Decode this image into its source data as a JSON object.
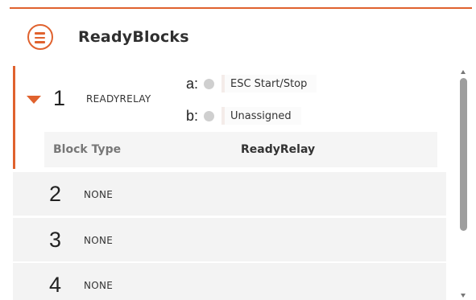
{
  "header": {
    "title": "ReadyBlocks",
    "menu_icon": "hamburger-menu-icon",
    "accent": "#e0622e"
  },
  "blocks": [
    {
      "number": "1",
      "type": "READYRELAY",
      "expanded": true,
      "inputs": [
        {
          "key": "a:",
          "value": "ESC Start/Stop"
        },
        {
          "key": "b:",
          "value": "Unassigned"
        }
      ],
      "detail": {
        "label": "Block Type",
        "value": "ReadyRelay"
      }
    },
    {
      "number": "2",
      "type": "NONE"
    },
    {
      "number": "3",
      "type": "NONE"
    },
    {
      "number": "4",
      "type": "NONE"
    }
  ]
}
